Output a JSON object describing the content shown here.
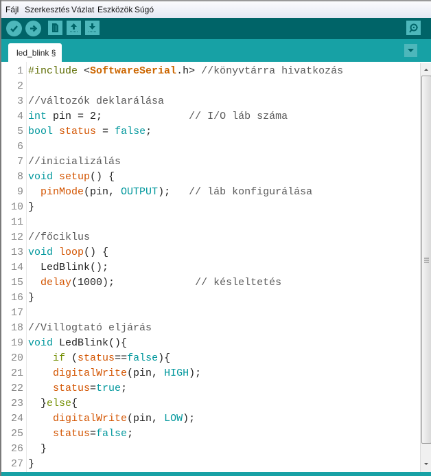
{
  "menu": [
    "Fájl",
    "Szerkesztés",
    "Vázlat",
    "Eszközök",
    "Súgó"
  ],
  "toolbar": {
    "buttons": [
      {
        "name": "verify-button",
        "icon": "check-icon"
      },
      {
        "name": "upload-button",
        "icon": "arrow-right-icon"
      },
      {
        "name": "new-button",
        "icon": "new-file-icon"
      },
      {
        "name": "open-button",
        "icon": "arrow-up-icon"
      },
      {
        "name": "save-button",
        "icon": "arrow-down-icon"
      }
    ],
    "serial_monitor": "serial-monitor-icon"
  },
  "tabs": [
    {
      "label": "led_blink §"
    }
  ],
  "colors": {
    "toolbar": "#006468",
    "tabbar": "#17a1a5",
    "keyword": "#00979c",
    "function": "#d35400"
  },
  "code": [
    {
      "n": "1",
      "t": [
        [
          "pp",
          "#include "
        ],
        [
          "",
          "<"
        ],
        [
          "lib",
          "SoftwareSerial"
        ],
        [
          "",
          ".h> "
        ],
        [
          "cm",
          "//könyvtárra hivatkozás"
        ]
      ]
    },
    {
      "n": "2",
      "t": []
    },
    {
      "n": "3",
      "t": [
        [
          "cm",
          "//változók deklarálása"
        ]
      ]
    },
    {
      "n": "4",
      "t": [
        [
          "kw",
          "int"
        ],
        [
          "",
          " pin = 2;              "
        ],
        [
          "cm",
          "// I/O láb száma"
        ]
      ]
    },
    {
      "n": "5",
      "t": [
        [
          "kw",
          "bool"
        ],
        [
          "",
          " "
        ],
        [
          "fn",
          "status"
        ],
        [
          "",
          " = "
        ],
        [
          "const",
          "false"
        ],
        [
          "",
          ";"
        ]
      ]
    },
    {
      "n": "6",
      "t": []
    },
    {
      "n": "7",
      "t": [
        [
          "cm",
          "//inicializálás"
        ]
      ]
    },
    {
      "n": "8",
      "t": [
        [
          "kw",
          "void"
        ],
        [
          "",
          " "
        ],
        [
          "fn",
          "setup"
        ],
        [
          "",
          "() {"
        ]
      ]
    },
    {
      "n": "9",
      "t": [
        [
          "",
          "  "
        ],
        [
          "fn",
          "pinMode"
        ],
        [
          "",
          "(pin, "
        ],
        [
          "const",
          "OUTPUT"
        ],
        [
          "",
          ");   "
        ],
        [
          "cm",
          "// láb konfigurálása"
        ]
      ]
    },
    {
      "n": "10",
      "t": [
        [
          "",
          "}"
        ]
      ]
    },
    {
      "n": "11",
      "t": []
    },
    {
      "n": "12",
      "t": [
        [
          "cm",
          "//főciklus"
        ]
      ]
    },
    {
      "n": "13",
      "t": [
        [
          "kw",
          "void"
        ],
        [
          "",
          " "
        ],
        [
          "fn",
          "loop"
        ],
        [
          "",
          "() {"
        ]
      ]
    },
    {
      "n": "14",
      "t": [
        [
          "",
          "  LedBlink();"
        ]
      ]
    },
    {
      "n": "15",
      "t": [
        [
          "",
          "  "
        ],
        [
          "fn",
          "delay"
        ],
        [
          "",
          "(1000);             "
        ],
        [
          "cm",
          "// késleltetés"
        ]
      ]
    },
    {
      "n": "16",
      "t": [
        [
          "",
          "}"
        ]
      ]
    },
    {
      "n": "17",
      "t": []
    },
    {
      "n": "18",
      "t": [
        [
          "cm",
          "//Villogtató eljárás"
        ]
      ]
    },
    {
      "n": "19",
      "t": [
        [
          "kw",
          "void"
        ],
        [
          "",
          " LedBlink(){"
        ]
      ]
    },
    {
      "n": "20",
      "t": [
        [
          "",
          "    "
        ],
        [
          "ctl",
          "if"
        ],
        [
          "",
          " ("
        ],
        [
          "fn",
          "status"
        ],
        [
          "",
          "=="
        ],
        [
          "const",
          "false"
        ],
        [
          "",
          "){"
        ]
      ]
    },
    {
      "n": "21",
      "t": [
        [
          "",
          "    "
        ],
        [
          "fn",
          "digitalWrite"
        ],
        [
          "",
          "(pin, "
        ],
        [
          "const",
          "HIGH"
        ],
        [
          "",
          ");"
        ]
      ]
    },
    {
      "n": "22",
      "t": [
        [
          "",
          "    "
        ],
        [
          "fn",
          "status"
        ],
        [
          "",
          "="
        ],
        [
          "const",
          "true"
        ],
        [
          "",
          ";"
        ]
      ]
    },
    {
      "n": "23",
      "t": [
        [
          "",
          "  }"
        ],
        [
          "ctl",
          "else"
        ],
        [
          "",
          "{"
        ]
      ]
    },
    {
      "n": "24",
      "t": [
        [
          "",
          "    "
        ],
        [
          "fn",
          "digitalWrite"
        ],
        [
          "",
          "(pin, "
        ],
        [
          "const",
          "LOW"
        ],
        [
          "",
          ");"
        ]
      ]
    },
    {
      "n": "25",
      "t": [
        [
          "",
          "    "
        ],
        [
          "fn",
          "status"
        ],
        [
          "",
          "="
        ],
        [
          "const",
          "false"
        ],
        [
          "",
          ";"
        ]
      ]
    },
    {
      "n": "26",
      "t": [
        [
          "",
          "  }"
        ]
      ]
    },
    {
      "n": "27",
      "t": [
        [
          "",
          "}"
        ]
      ]
    }
  ]
}
